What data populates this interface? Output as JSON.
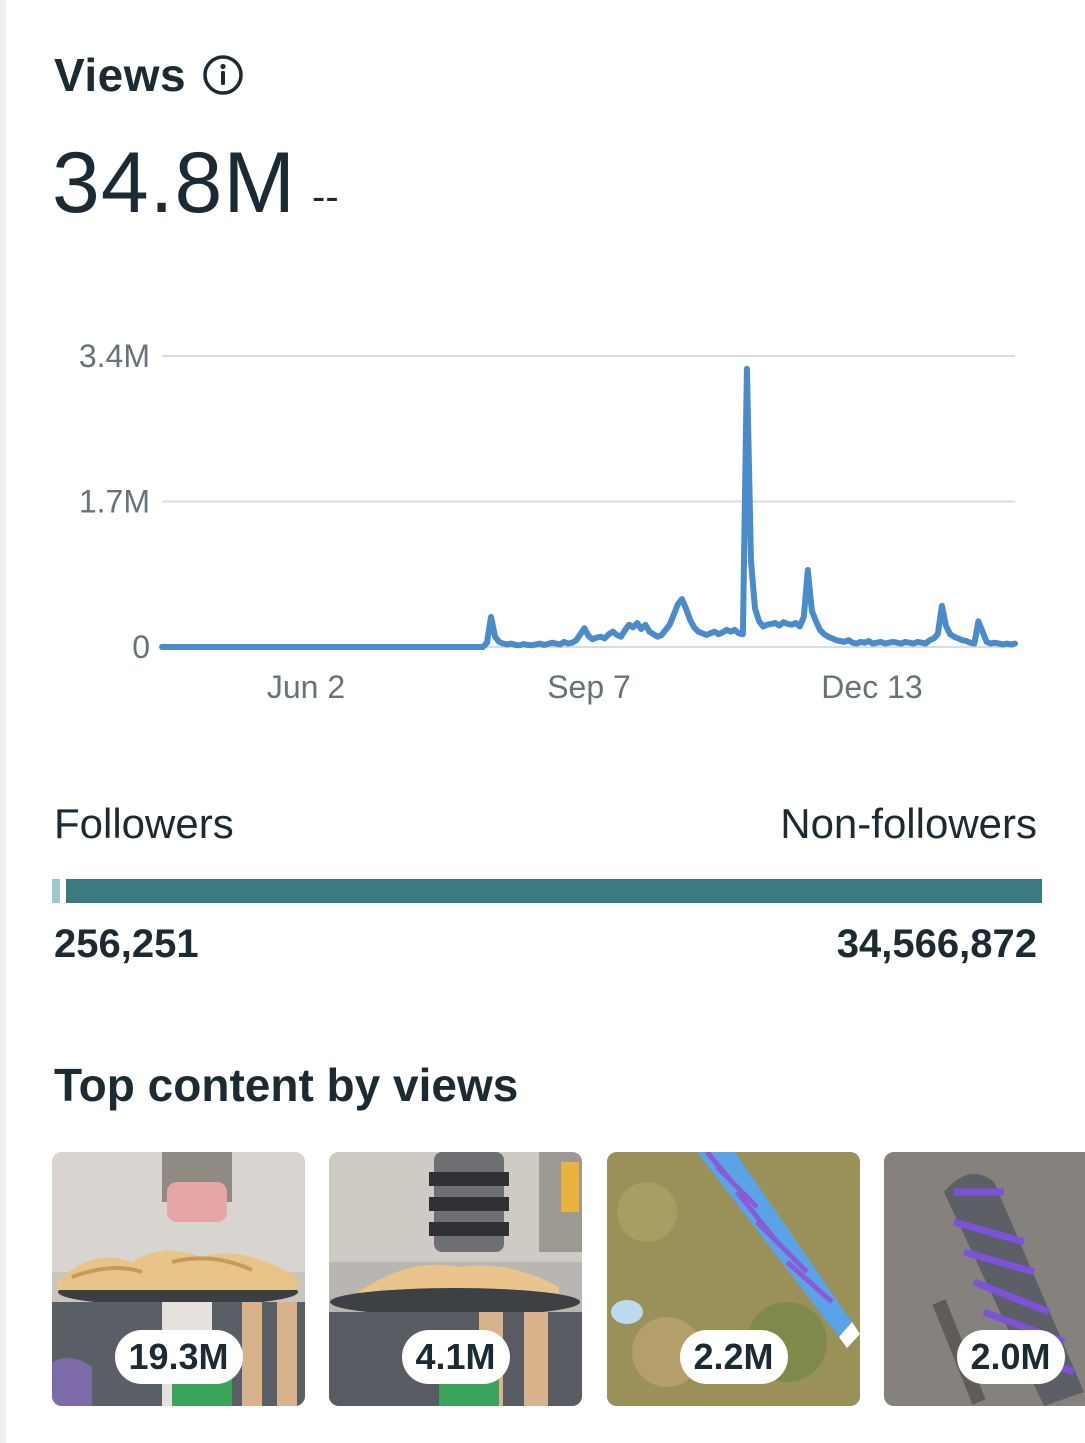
{
  "header": {
    "title": "Views",
    "total": "34.8M",
    "delta": "--"
  },
  "chart_data": {
    "type": "line",
    "title": "",
    "xlabel": "",
    "ylabel": "",
    "y_ticks": [
      "3.4M",
      "1.7M",
      "0"
    ],
    "x_ticks": [
      "Jun 2",
      "Sep 7",
      "Dec 13"
    ],
    "ylim": [
      0,
      3400000
    ],
    "grid": true,
    "line_color": "#4a8ccb",
    "series": [
      {
        "values": [
          0,
          0,
          0,
          0,
          0,
          0,
          0,
          0,
          0,
          0,
          0,
          0,
          0,
          0,
          0,
          0,
          0,
          0,
          0,
          0,
          0,
          0,
          0,
          0,
          0,
          0,
          0,
          0,
          0,
          0,
          0,
          0,
          0,
          0,
          0,
          0,
          0,
          0,
          0,
          0,
          0,
          0,
          0,
          0,
          0,
          0,
          0,
          0,
          0,
          0,
          0,
          0,
          0,
          0,
          0,
          0,
          0,
          0,
          0,
          0,
          0,
          0,
          0,
          0,
          0,
          0,
          0,
          0,
          0,
          0,
          0,
          0,
          0,
          0,
          0,
          0,
          0,
          0,
          0,
          0,
          50000,
          350000,
          120000,
          60000,
          40000,
          30000,
          40000,
          25000,
          20000,
          35000,
          25000,
          20000,
          30000,
          40000,
          25000,
          35000,
          50000,
          40000,
          30000,
          60000,
          40000,
          50000,
          80000,
          150000,
          220000,
          130000,
          90000,
          110000,
          120000,
          100000,
          150000,
          180000,
          140000,
          120000,
          200000,
          260000,
          230000,
          280000,
          210000,
          260000,
          180000,
          150000,
          120000,
          140000,
          200000,
          260000,
          380000,
          500000,
          560000,
          450000,
          320000,
          230000,
          180000,
          160000,
          140000,
          160000,
          180000,
          150000,
          170000,
          200000,
          180000,
          200000,
          160000,
          150000,
          3250000,
          1000000,
          450000,
          300000,
          240000,
          260000,
          270000,
          280000,
          250000,
          290000,
          270000,
          260000,
          280000,
          240000,
          350000,
          900000,
          420000,
          300000,
          200000,
          150000,
          120000,
          100000,
          80000,
          70000,
          60000,
          80000,
          50000,
          40000,
          60000,
          50000,
          70000,
          40000,
          50000,
          60000,
          40000,
          50000,
          60000,
          50000,
          40000,
          60000,
          50000,
          40000,
          60000,
          50000,
          40000,
          80000,
          100000,
          150000,
          480000,
          250000,
          150000,
          120000,
          100000,
          80000,
          70000,
          50000,
          40000,
          300000,
          180000,
          60000,
          40000,
          50000,
          40000,
          30000,
          40000,
          30000,
          40000
        ]
      }
    ]
  },
  "audience": {
    "followers_label": "Followers",
    "non_followers_label": "Non-followers",
    "followers_value": "256,251",
    "non_followers_value": "34,566,872",
    "followers_share": 0.0074,
    "followers_color": "#9cc9c8",
    "non_followers_color": "#3b7b80"
  },
  "top_content": {
    "title": "Top content by views",
    "items": [
      {
        "views": "19.3M",
        "icon": "wood-shavings-drill-thumbnail"
      },
      {
        "views": "4.1M",
        "icon": "drill-press-thumbnail"
      },
      {
        "views": "2.2M",
        "icon": "blue-bat-on-grass-thumbnail"
      },
      {
        "views": "2.0M",
        "icon": "purple-wrapped-bat-thumbnail"
      }
    ]
  }
}
